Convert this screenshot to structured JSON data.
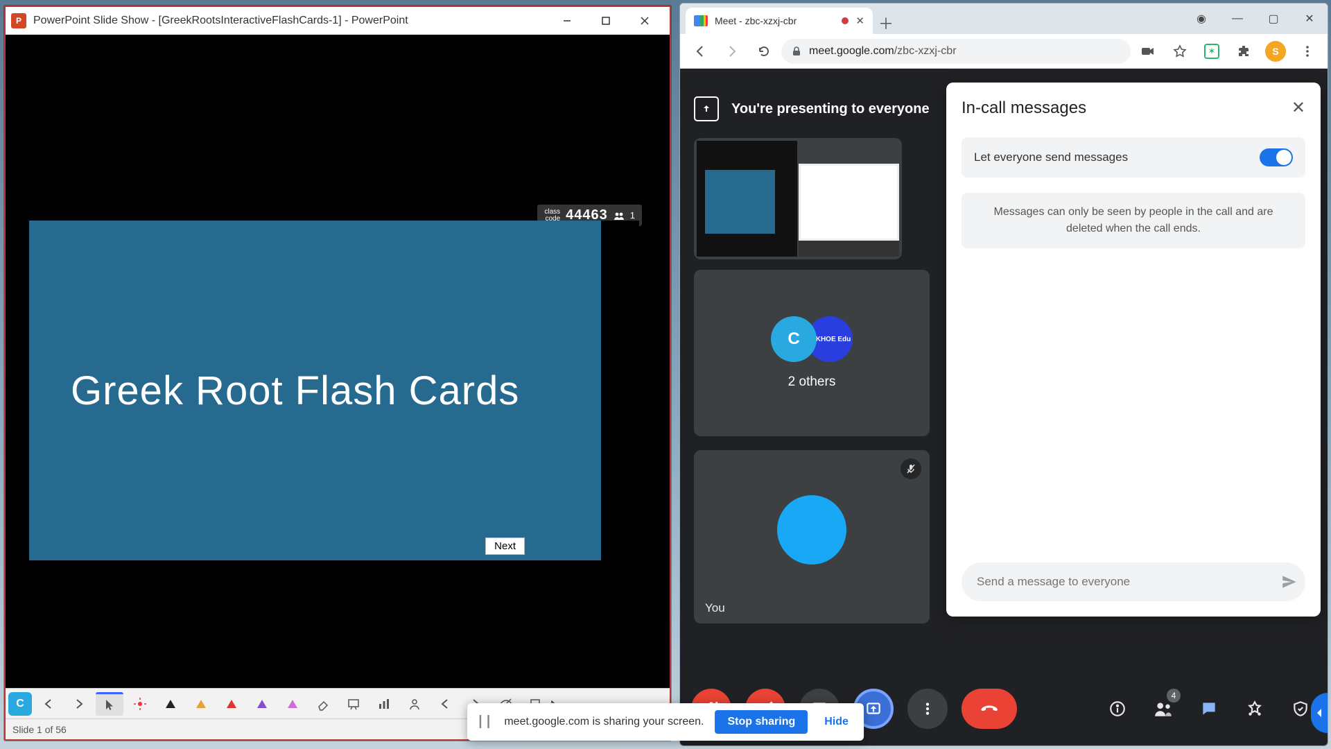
{
  "powerpoint": {
    "title": "PowerPoint Slide Show - [GreekRootsInteractiveFlashCards-1] - PowerPoint",
    "app_icon_letter": "P",
    "class_badge": {
      "label_line1": "class",
      "label_line2": "code",
      "code": "44463",
      "count": "1"
    },
    "slide_title": "Greek Root Flash Cards",
    "next_tooltip": "Next",
    "classpoint_letter": "C",
    "status_text": "Slide 1 of 56"
  },
  "chrome": {
    "tab_title": "Meet - zbc-xzxj-cbr",
    "url_host": "meet.google.com",
    "url_path": "/zbc-xzxj-cbr",
    "avatar_letter": "S"
  },
  "meet": {
    "presenting_text": "You're presenting to everyone",
    "others_label": "2 others",
    "others_avatar2_text": "INKHOE Edu",
    "you_label": "You",
    "people_badge": "4"
  },
  "chat": {
    "title": "In-call messages",
    "toggle_label": "Let everyone send messages",
    "info_text": "Messages can only be seen by people in the call and are deleted when the call ends.",
    "placeholder": "Send a message to everyone"
  },
  "share_toast": {
    "text": "meet.google.com is sharing your screen.",
    "stop": "Stop sharing",
    "hide": "Hide"
  }
}
